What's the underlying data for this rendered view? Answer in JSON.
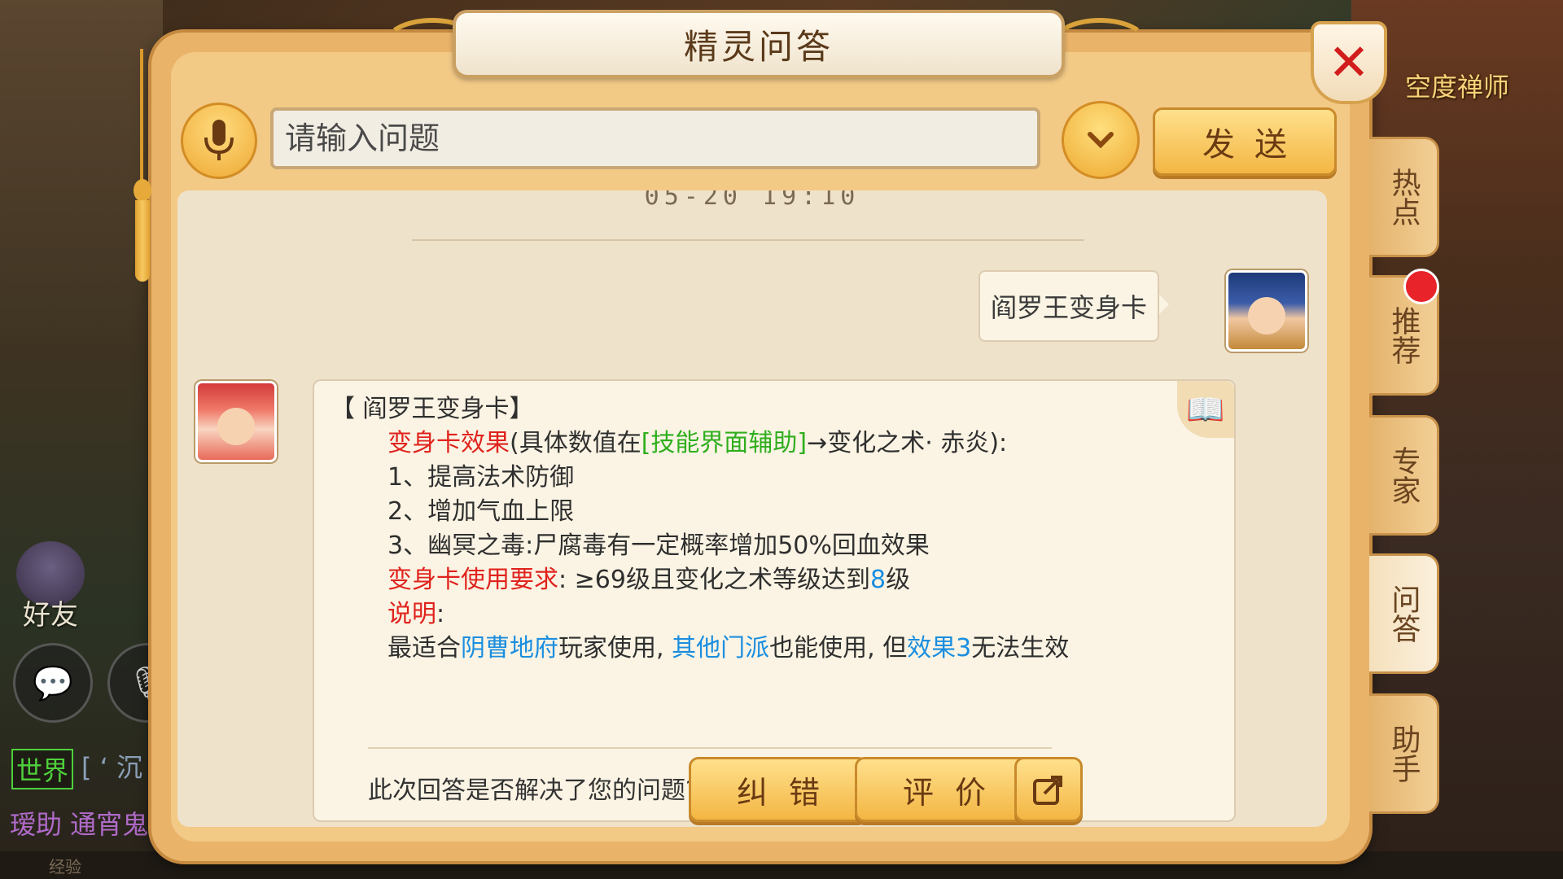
{
  "background": {
    "npc_name": "空度禅师",
    "friend_label": "好友",
    "chat_channel": "世界",
    "chat_channel_text": "[ ‘  沉",
    "chat_line": "瑷助  通宵鬼",
    "bottom_text": "经验"
  },
  "dialog": {
    "title": "精灵问答",
    "close_label": "✕",
    "input_placeholder": "请输入问题",
    "send_label": "发送"
  },
  "chat": {
    "timestamp": "05-20 19:10",
    "user_message": "阎罗王变身卡",
    "answer": {
      "heading": "【 阎罗王变身卡】",
      "effect_label": "变身卡效果",
      "effect_pre": "(具体数值在",
      "effect_link": "[技能界面辅助]",
      "effect_post": "→变化之术· 赤炎):",
      "item1": "1、提高法术防御",
      "item2": "2、增加气血上限",
      "item3": "3、幽冥之毒:尸腐毒有一定概率增加50%回血效果",
      "req_label": "变身卡使用要求",
      "req_pre": ":  ≥69级且变化之术等级达到",
      "req_level": "8",
      "req_post": "级",
      "note_label": "说明",
      "note_colon": ":",
      "note_pre": "最适合",
      "note_link1": "阴曹地府",
      "note_mid1": "玩家使用,  ",
      "note_link2": "其他门派",
      "note_mid2": "也能使用,  但",
      "note_link3": "效果3",
      "note_post": "无法生效"
    },
    "feedback_question": "此次回答是否解决了您的问题?",
    "correct_label": "纠错",
    "rate_label": "评价"
  },
  "side_tabs": [
    {
      "label": "热点"
    },
    {
      "label": "推荐"
    },
    {
      "label": "专家"
    },
    {
      "label": "问答"
    },
    {
      "label": "助手"
    }
  ],
  "colors": {
    "highlight_red": "#e0221d",
    "link_green": "#2fae1e",
    "link_blue": "#1a8ee0",
    "button_gold": "#f3b643"
  }
}
